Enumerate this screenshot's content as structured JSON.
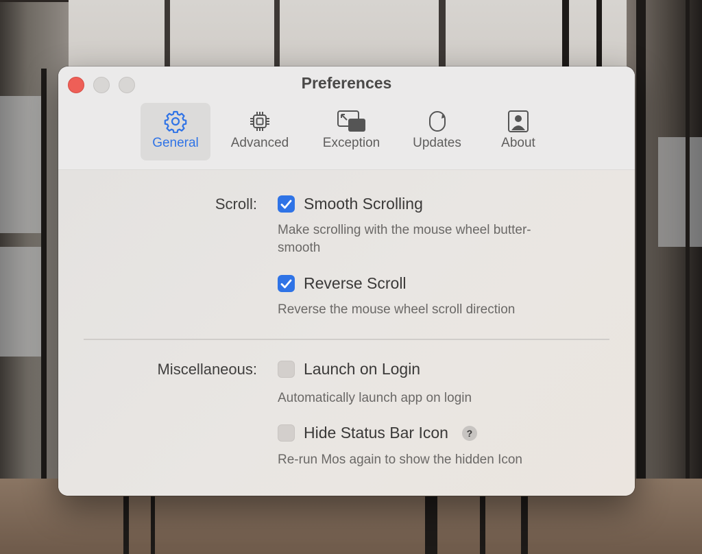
{
  "window": {
    "title": "Preferences"
  },
  "tabs": [
    {
      "label": "General",
      "icon": "gear-icon",
      "active": true
    },
    {
      "label": "Advanced",
      "icon": "chip-icon",
      "active": false
    },
    {
      "label": "Exception",
      "icon": "window-exception-icon",
      "active": false
    },
    {
      "label": "Updates",
      "icon": "refresh-icon",
      "active": false
    },
    {
      "label": "About",
      "icon": "person-icon",
      "active": false
    }
  ],
  "scroll": {
    "label": "Scroll:",
    "smooth": {
      "label": "Smooth Scrolling",
      "checked": true,
      "description": "Make scrolling with the mouse wheel butter-smooth"
    },
    "reverse": {
      "label": "Reverse Scroll",
      "checked": true,
      "description": "Reverse the mouse wheel scroll direction"
    }
  },
  "misc": {
    "label": "Miscellaneous:",
    "launch": {
      "label": "Launch on Login",
      "checked": false,
      "description": "Automatically launch app on login"
    },
    "hide_icon": {
      "label": "Hide Status Bar Icon",
      "checked": false,
      "help": "?",
      "description": "Re-run Mos again to show the hidden Icon"
    }
  },
  "colors": {
    "accent": "#2f73e6",
    "close": "#ee5f57"
  }
}
